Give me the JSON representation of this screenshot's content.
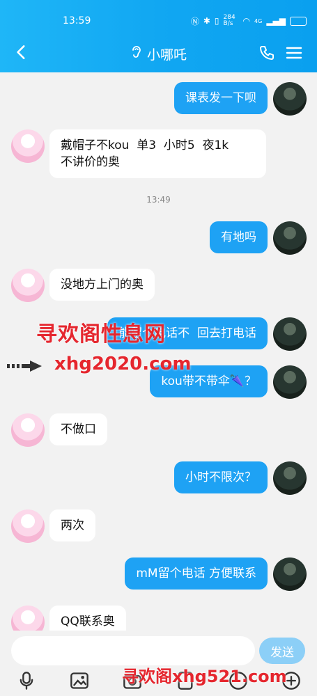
{
  "status_bar": {
    "time": "13:59",
    "net": "284 B/s",
    "signal": "4G"
  },
  "header": {
    "title": "小哪吒"
  },
  "chat": {
    "messages": [
      {
        "side": "right",
        "text": "课表发一下呗"
      },
      {
        "side": "left",
        "text": "戴帽子不kou  单3  小时5  夜1k\n不讲价的奥"
      },
      {
        "side": "time",
        "text": "13:49"
      },
      {
        "side": "right",
        "text": "有地吗"
      },
      {
        "side": "left",
        "text": "没地方上门的奥"
      },
      {
        "side": "right",
        "text": "能留个电话不  回去打电话"
      },
      {
        "side": "right",
        "text": "kou带不带伞🌂？"
      },
      {
        "side": "left",
        "text": "不做口"
      },
      {
        "side": "right",
        "text": "小时不限次？"
      },
      {
        "side": "left",
        "text": "两次"
      },
      {
        "side": "right",
        "text": "mM留个电话 方便联系"
      },
      {
        "side": "left",
        "text": "QQ联系奥"
      }
    ]
  },
  "input": {
    "placeholder": "",
    "send_label": "发送"
  },
  "watermarks": {
    "top": "寻欢阁性息网",
    "middle": "xhg2020.com",
    "bottom": "寻欢阁xhg521.com"
  },
  "colors": {
    "header": "#11a7f2",
    "bubble_right": "#1ea2f4",
    "bubble_left": "#ffffff",
    "watermark": "#e5262e"
  }
}
